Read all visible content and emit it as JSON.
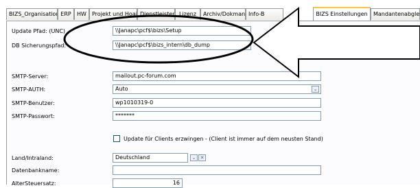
{
  "tabs": [
    {
      "label": "BIZS_Organisation"
    },
    {
      "label": "ERP"
    },
    {
      "label": "HW"
    },
    {
      "label": "Projekt und Hoai"
    },
    {
      "label": "Dienstleister"
    },
    {
      "label": "Lizenz"
    },
    {
      "label": "Archiv/Dokman"
    },
    {
      "label": "Info-B"
    },
    {
      "label": "BIZS Einstellungen"
    },
    {
      "label": "Mandantenabgle"
    }
  ],
  "form": {
    "update_path_label": "Update Pfad: (UNC)",
    "update_path_value": "\\\\Janapc\\pcf$\\bizs\\Setup",
    "db_backup_label": "DB Sicherungspfad:",
    "db_backup_value": "\\\\Janapc\\pcf$\\bizs_intern\\db_dump",
    "smtp_server_label": "SMTP-Server:",
    "smtp_server_value": "mailout.pc-forum.com",
    "smtp_auth_label": "SMTP-AUTH:",
    "smtp_auth_value": "Auto",
    "smtp_user_label": "SMTP-Benutzer:",
    "smtp_user_value": "wp1010319-0",
    "smtp_password_label": "SMTP-Passwort:",
    "smtp_password_value": "*******",
    "force_update_label": "Update für Clients erzwingen - (Client ist immer auf dem neusten Stand)",
    "country_label": "Land/Intraland:",
    "country_value": "Deutschland",
    "db_name_label": "Datenbankname:",
    "db_name_value": "",
    "tax_label": "AlterSteuersatz:",
    "tax_value": "16"
  },
  "annotation": {
    "color": "#000000"
  }
}
